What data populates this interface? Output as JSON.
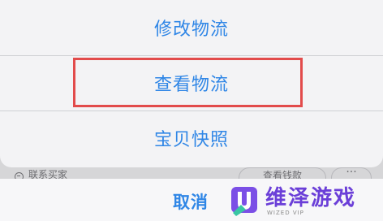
{
  "action_sheet": {
    "items": [
      {
        "label": "修改物流"
      },
      {
        "label": "查看物流",
        "highlighted": true
      },
      {
        "label": "宝贝快照"
      }
    ],
    "cancel_label": "取消"
  },
  "background_bar": {
    "contact_label": "联系买家",
    "view_money_label": "查看钱款",
    "more_label": "···"
  },
  "watermark": {
    "title": "维泽游戏",
    "subtitle": "WIZED VIP"
  },
  "colors": {
    "accent": "#2f86e6",
    "highlight_border": "#e24b4b",
    "watermark": "#6b3fd8"
  }
}
